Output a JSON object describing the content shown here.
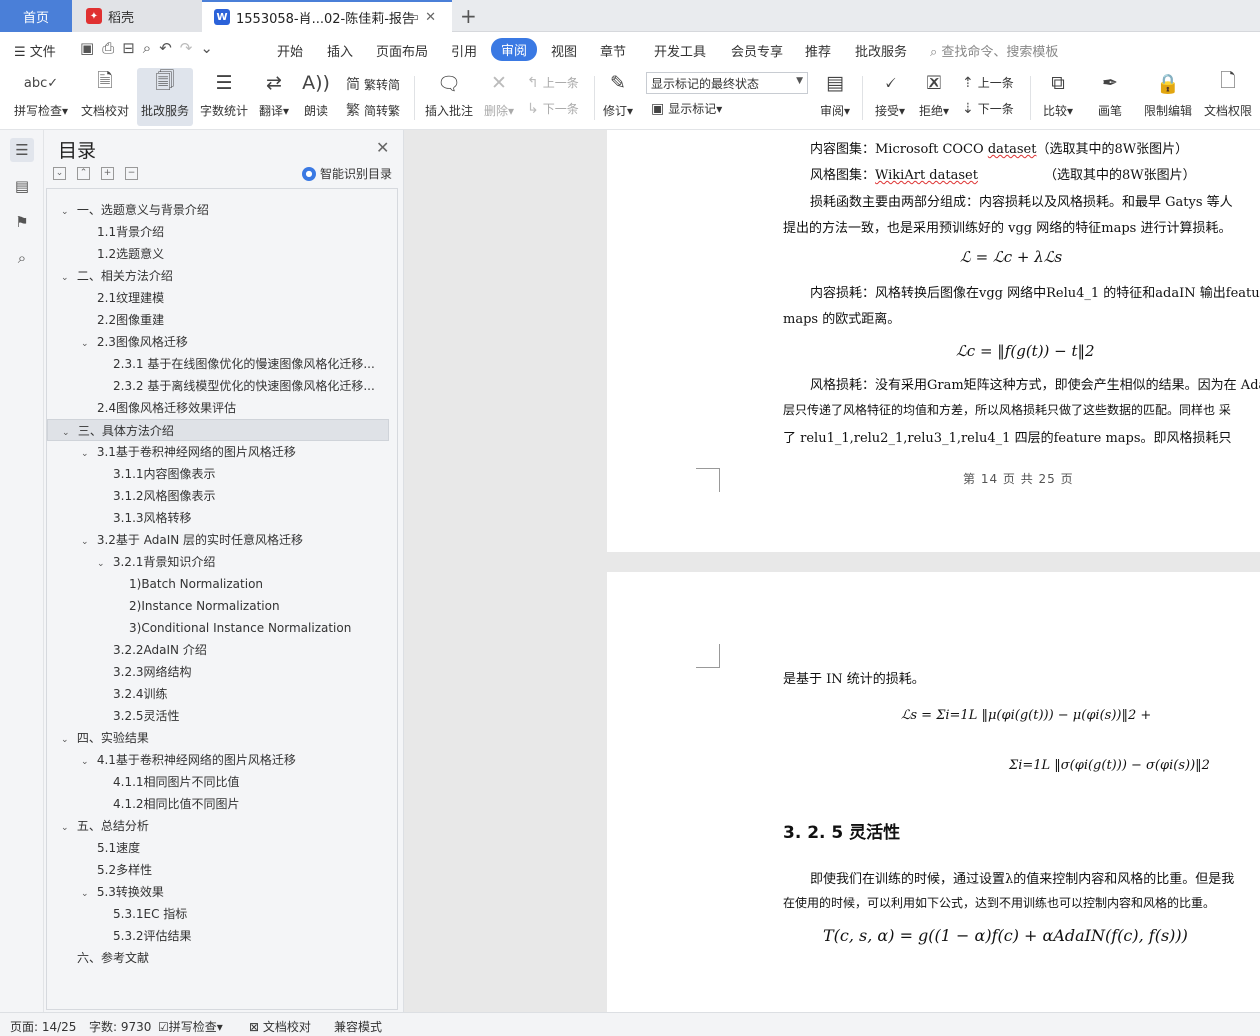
{
  "tabs": {
    "home": "首页",
    "daoke": "稻壳",
    "document": "1553058-肖...02-陈佳莉-报告"
  },
  "menu": {
    "file": "文件",
    "items": [
      "开始",
      "插入",
      "页面布局",
      "引用",
      "审阅",
      "视图",
      "章节",
      "开发工具",
      "会员专享",
      "推荐",
      "批改服务"
    ],
    "active": "审阅",
    "search": "查找命令、搜索模板"
  },
  "toolbar": {
    "spell_check": "拼写检查",
    "doc_proof": "文档校对",
    "correction_service": "批改服务",
    "word_count": "字数统计",
    "translate": "翻译",
    "read_aloud": "朗读",
    "trad_to_simp": "繁转简",
    "simp_to_trad": "简转繁",
    "insert_comment": "插入批注",
    "delete": "删除",
    "prev_comment": "上一条",
    "next_comment": "下一条",
    "track_changes": "修订",
    "markup_state": "显示标记的最终状态",
    "show_markup": "显示标记",
    "review": "审阅",
    "accept": "接受",
    "reject": "拒绝",
    "prev_change": "上一条",
    "next_change": "下一条",
    "compare": "比较",
    "ink": "画笔",
    "restrict_edit": "限制编辑",
    "doc_permission": "文档权限"
  },
  "toc": {
    "title": "目录",
    "smart_label": "智能识别目录",
    "items": [
      {
        "text": "一、选题意义与背景介绍",
        "level": 1,
        "arrow": true
      },
      {
        "text": "1.1背景介绍",
        "level": 2,
        "arrow": false
      },
      {
        "text": "1.2选题意义",
        "level": 2,
        "arrow": false
      },
      {
        "text": "二、相关方法介绍",
        "level": 1,
        "arrow": true
      },
      {
        "text": "2.1纹理建模",
        "level": 2,
        "arrow": false
      },
      {
        "text": "2.2图像重建",
        "level": 2,
        "arrow": false
      },
      {
        "text": "2.3图像风格迁移",
        "level": 2,
        "arrow": true
      },
      {
        "text": "2.3.1 基于在线图像优化的慢速图像风格化迁移...",
        "level": 3,
        "arrow": false
      },
      {
        "text": "2.3.2 基于离线模型优化的快速图像风格化迁移...",
        "level": 3,
        "arrow": false
      },
      {
        "text": "2.4图像风格迁移效果评估",
        "level": 2,
        "arrow": false
      },
      {
        "text": "三、具体方法介绍",
        "level": 1,
        "arrow": true,
        "selected": true
      },
      {
        "text": "3.1基于卷积神经网络的图片风格迁移",
        "level": 2,
        "arrow": true
      },
      {
        "text": "3.1.1内容图像表示",
        "level": 3,
        "arrow": false
      },
      {
        "text": "3.1.2风格图像表示",
        "level": 3,
        "arrow": false
      },
      {
        "text": "3.1.3风格转移",
        "level": 3,
        "arrow": false
      },
      {
        "text": "3.2基于 AdaIN 层的实时任意风格迁移",
        "level": 2,
        "arrow": true
      },
      {
        "text": "3.2.1背景知识介绍",
        "level": 3,
        "arrow": true
      },
      {
        "text": "1)Batch Normalization",
        "level": 4,
        "arrow": false
      },
      {
        "text": "2)Instance Normalization",
        "level": 4,
        "arrow": false
      },
      {
        "text": "3)Conditional Instance Normalization",
        "level": 4,
        "arrow": false
      },
      {
        "text": "3.2.2AdaIN 介绍",
        "level": 3,
        "arrow": false
      },
      {
        "text": "3.2.3网络结构",
        "level": 3,
        "arrow": false
      },
      {
        "text": "3.2.4训练",
        "level": 3,
        "arrow": false
      },
      {
        "text": "3.2.5灵活性",
        "level": 3,
        "arrow": false
      },
      {
        "text": "四、实验结果",
        "level": 1,
        "arrow": true
      },
      {
        "text": "4.1基于卷积神经网络的图片风格迁移",
        "level": 2,
        "arrow": true
      },
      {
        "text": "4.1.1相同图片不同比值",
        "level": 3,
        "arrow": false
      },
      {
        "text": "4.1.2相同比值不同图片",
        "level": 3,
        "arrow": false
      },
      {
        "text": "五、总结分析",
        "level": 1,
        "arrow": true
      },
      {
        "text": "5.1速度",
        "level": 2,
        "arrow": false
      },
      {
        "text": "5.2多样性",
        "level": 2,
        "arrow": false
      },
      {
        "text": "5.3转换效果",
        "level": 2,
        "arrow": true
      },
      {
        "text": "5.3.1EC 指标",
        "level": 3,
        "arrow": false
      },
      {
        "text": "5.3.2评估结果",
        "level": 3,
        "arrow": false
      },
      {
        "text": "六、参考文献",
        "level": 1,
        "arrow": false
      }
    ]
  },
  "document": {
    "page1": {
      "l1_a": "内容图集：Microsoft COCO ",
      "l1_b": "dataset",
      "l1_c": "（选取其中的8W张图片）",
      "l2_a": "风格图集：",
      "l2_b": "WikiArt dataset",
      "l2_c": "（选取其中的8W张图片）",
      "l3": "损耗函数主要由两部分组成：内容损耗以及风格损耗。和最早 Gatys 等人",
      "l4": "提出的方法一致，也是采用预训练好的 vgg 网络的特征maps 进行计算损耗。",
      "eq1": "ℒ = ℒc + λℒs",
      "l5": "内容损耗：风格转换后图像在vgg 网络中Relu4_1 的特征和adaIN 输出feature",
      "l6": "maps 的欧式距离。",
      "eq2": "ℒc = ‖f(g(t)) − t‖2",
      "l7": "风格损耗：没有采用Gram矩阵这种方式，即使会产生相似的结果。因为在 Ada",
      "l8": "层只传递了风格特征的均值和方差，所以风格损耗只做了这些数据的匹配。同样也 采",
      "l9": "了 relu1_1,relu2_1,relu3_1,relu4_1 四层的feature maps。即风格损耗只",
      "footer": "第 14 页  共 25 页"
    },
    "page2": {
      "l1": "是基于 IN 统计的损耗。",
      "eq3a": "ℒs = Σi=1L ‖μ(φi(g(t))) − μ(φi(s))‖2  +",
      "eq3b": "Σi=1L ‖σ(φi(g(t))) − σ(φi(s))‖2",
      "heading": "3. 2. 5  灵活性",
      "l2": "即使我们在训练的时候，通过设置λ的值来控制内容和风格的比重。但是我",
      "l3": "在使用的时候，可以利用如下公式，达到不用训练也可以控制内容和风格的比重。",
      "eq4": "T(c, s, α) = g((1 − α)f(c) + αAdaIN(f(c), f(s)))"
    }
  },
  "status": {
    "page": "页面: 14/25",
    "words": "字数: 9730",
    "spell": "拼写检查",
    "proof": "文档校对",
    "compat": "兼容模式"
  },
  "colors": {
    "accent": "#3a79e3",
    "home_tab": "#4a7fd8",
    "daoke_red": "#e03131"
  }
}
